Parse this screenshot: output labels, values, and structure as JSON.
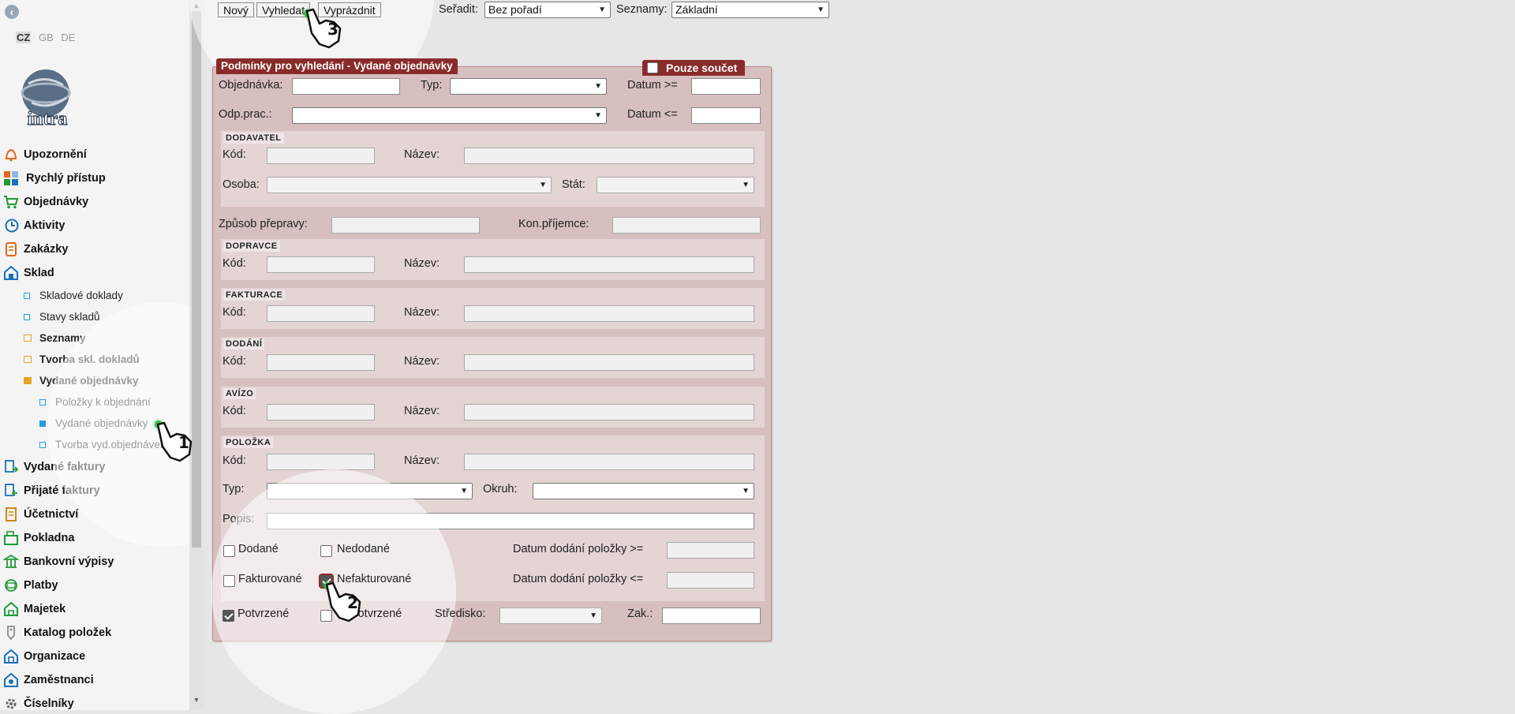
{
  "languages": [
    "CZ",
    "GB",
    "DE"
  ],
  "logo": {
    "text": "intra"
  },
  "nav": [
    {
      "label": "Upozornění",
      "icon": "bell-icon",
      "color": "#e0661a"
    },
    {
      "label": "Rychlý přístup",
      "icon": "tiles-icon",
      "color": "#e0661a"
    },
    {
      "label": "Objednávky",
      "icon": "cart-icon",
      "color": "#1e9a3a"
    },
    {
      "label": "Aktivity",
      "icon": "clock-icon",
      "color": "#1c6fb8"
    },
    {
      "label": "Zakázky",
      "icon": "clipboard-icon",
      "color": "#e0661a"
    },
    {
      "label": "Sklad",
      "icon": "warehouse-icon",
      "color": "#1c6fb8"
    }
  ],
  "sklad_children": [
    {
      "label": "Skladové doklady"
    },
    {
      "label": "Stavy skladů"
    },
    {
      "label": "Seznamy"
    },
    {
      "label": "Tvorba skl. dokladů"
    },
    {
      "label": "Vydané objednávky"
    }
  ],
  "vydane_children": [
    {
      "label": "Položky k objednání"
    },
    {
      "label": "Vydané objednávky"
    },
    {
      "label": "Tvorba vyd.objednávek"
    }
  ],
  "nav_bottom": [
    {
      "label": "Vydané faktury",
      "icon": "invoice-out-icon"
    },
    {
      "label": "Přijaté faktury",
      "icon": "invoice-in-icon"
    },
    {
      "label": "Účetnictví",
      "icon": "ledger-icon"
    },
    {
      "label": "Pokladna",
      "icon": "cashbox-icon"
    },
    {
      "label": "Bankovní výpisy",
      "icon": "bank-icon"
    },
    {
      "label": "Platby",
      "icon": "payment-icon"
    },
    {
      "label": "Majetek",
      "icon": "property-icon"
    },
    {
      "label": "Katalog položek",
      "icon": "tag-icon"
    },
    {
      "label": "Organizace",
      "icon": "building-icon"
    },
    {
      "label": "Zaměstnanci",
      "icon": "employees-icon"
    },
    {
      "label": "Číselníky",
      "icon": "gear-icon"
    }
  ],
  "toolbar": {
    "new": "Nový",
    "search": "Vyhledat",
    "clear": "Vyprázdnit",
    "sort_label": "Seřadit:",
    "sort_value": "Bez pořadí",
    "lists_label": "Seznamy:",
    "lists_value": "Základní"
  },
  "form": {
    "title": "Podmínky pro vyhledání - Vydané objednávky",
    "sum_only": "Pouze součet",
    "objednavka": "Objednávka:",
    "typ": "Typ:",
    "datum_from": "Datum >=",
    "odp_prac": "Odp.prac.:",
    "datum_to": "Datum <=",
    "kod": "Kód:",
    "nazev": "Název:",
    "osoba": "Osoba:",
    "stat": "Stát:",
    "zpusob": "Způsob přepravy:",
    "kon_prijemce": "Kon.příjemce:",
    "sections": {
      "dodavatel": "DODAVATEL",
      "dopravce": "DOPRAVCE",
      "fakturace": "FAKTURACE",
      "dodani": "DODÁNÍ",
      "avizo": "AVÍZO",
      "polozka": "POLOŽKA"
    },
    "okruh": "Okruh:",
    "popis": "Popis:",
    "dodane": "Dodané",
    "nedodane": "Nedodané",
    "fakturovane": "Fakturované",
    "nefakturovane": "Nefakturované",
    "datum_dod_from": "Datum dodání položky >=",
    "datum_dod_to": "Datum dodání položky <=",
    "potvrzene": "Potvrzené",
    "nepotvrzene": "Nepotvrzené",
    "stredisko": "Středisko:",
    "zak": "Zak.:"
  },
  "checks": {
    "dodane": false,
    "nedodane": false,
    "fakturovane": false,
    "nefakturovane": true,
    "potvrzene": true,
    "nepotvrzene": false,
    "sum_only": false
  },
  "steps": [
    "1",
    "2",
    "3"
  ]
}
